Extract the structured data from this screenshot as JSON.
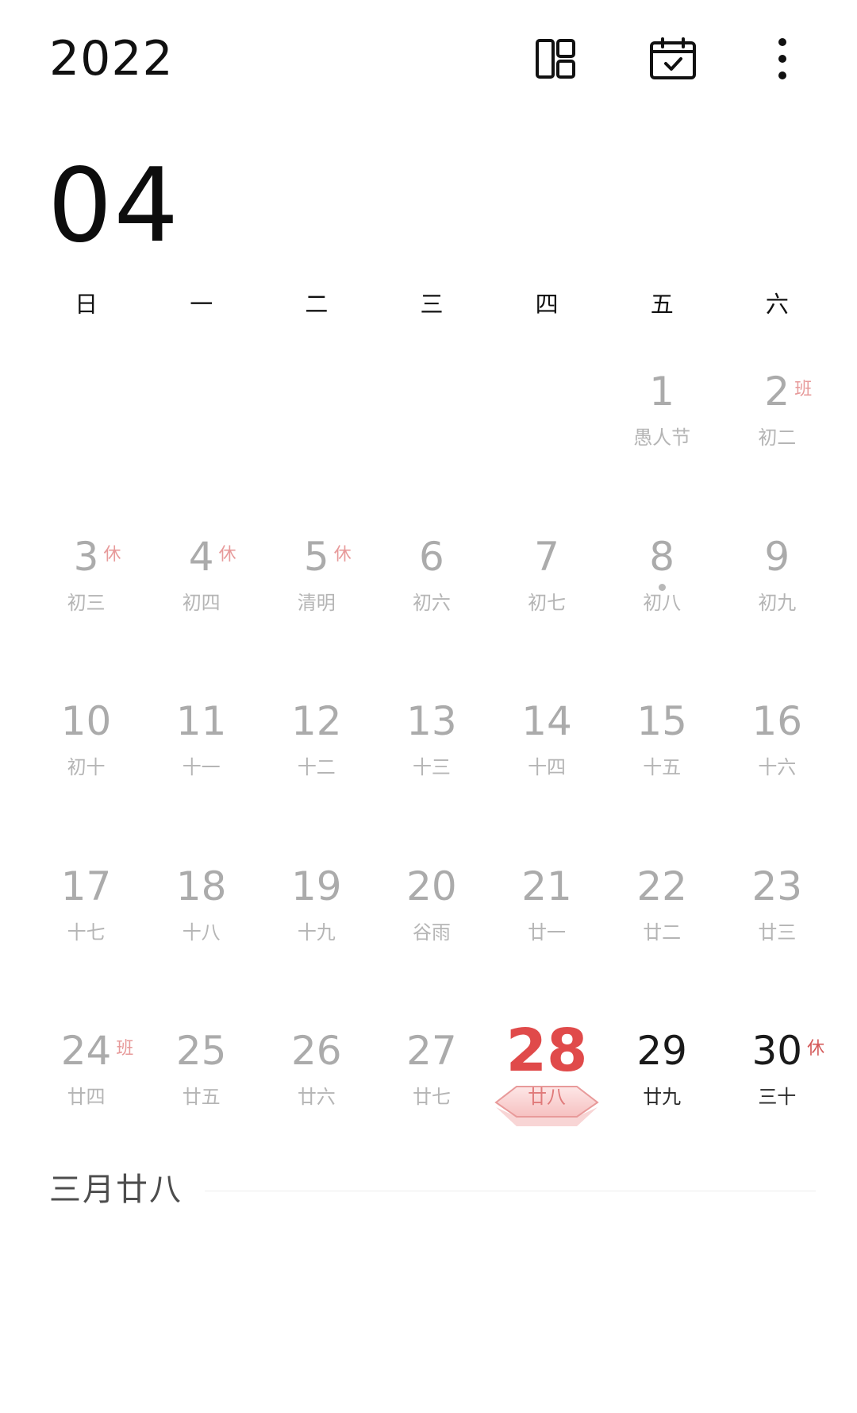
{
  "header": {
    "year": "2022",
    "month": "04",
    "icons": [
      "layout-icon",
      "calendar-today-icon",
      "more-vertical-icon"
    ]
  },
  "weekdays": [
    "日",
    "一",
    "二",
    "三",
    "四",
    "五",
    "六"
  ],
  "weeks": [
    [
      null,
      null,
      null,
      null,
      null,
      {
        "day": "1",
        "lunar": "愚人节"
      },
      {
        "day": "2",
        "lunar": "初二",
        "badge": "班"
      }
    ],
    [
      {
        "day": "3",
        "lunar": "初三",
        "badge": "休"
      },
      {
        "day": "4",
        "lunar": "初四",
        "badge": "休"
      },
      {
        "day": "5",
        "lunar": "清明",
        "badge": "休"
      },
      {
        "day": "6",
        "lunar": "初六"
      },
      {
        "day": "7",
        "lunar": "初七"
      },
      {
        "day": "8",
        "lunar": "初八",
        "dot": true
      },
      {
        "day": "9",
        "lunar": "初九"
      }
    ],
    [
      {
        "day": "10",
        "lunar": "初十"
      },
      {
        "day": "11",
        "lunar": "十一"
      },
      {
        "day": "12",
        "lunar": "十二"
      },
      {
        "day": "13",
        "lunar": "十三"
      },
      {
        "day": "14",
        "lunar": "十四"
      },
      {
        "day": "15",
        "lunar": "十五"
      },
      {
        "day": "16",
        "lunar": "十六"
      }
    ],
    [
      {
        "day": "17",
        "lunar": "十七"
      },
      {
        "day": "18",
        "lunar": "十八"
      },
      {
        "day": "19",
        "lunar": "十九"
      },
      {
        "day": "20",
        "lunar": "谷雨"
      },
      {
        "day": "21",
        "lunar": "廿一"
      },
      {
        "day": "22",
        "lunar": "廿二"
      },
      {
        "day": "23",
        "lunar": "廿三"
      }
    ],
    [
      {
        "day": "24",
        "lunar": "廿四",
        "badge": "班"
      },
      {
        "day": "25",
        "lunar": "廿五"
      },
      {
        "day": "26",
        "lunar": "廿六"
      },
      {
        "day": "27",
        "lunar": "廿七"
      },
      {
        "day": "28",
        "lunar": "廿八",
        "state": "today"
      },
      {
        "day": "29",
        "lunar": "廿九",
        "state": "future"
      },
      {
        "day": "30",
        "lunar": "三十",
        "badge": "休",
        "state": "future"
      }
    ]
  ],
  "selected_lunar_date": "三月廿八",
  "colors": {
    "today_red": "#e04a4a",
    "badge_pink": "#e79a9a",
    "past_gray": "#ababab",
    "future_black": "#1a1a1a"
  }
}
